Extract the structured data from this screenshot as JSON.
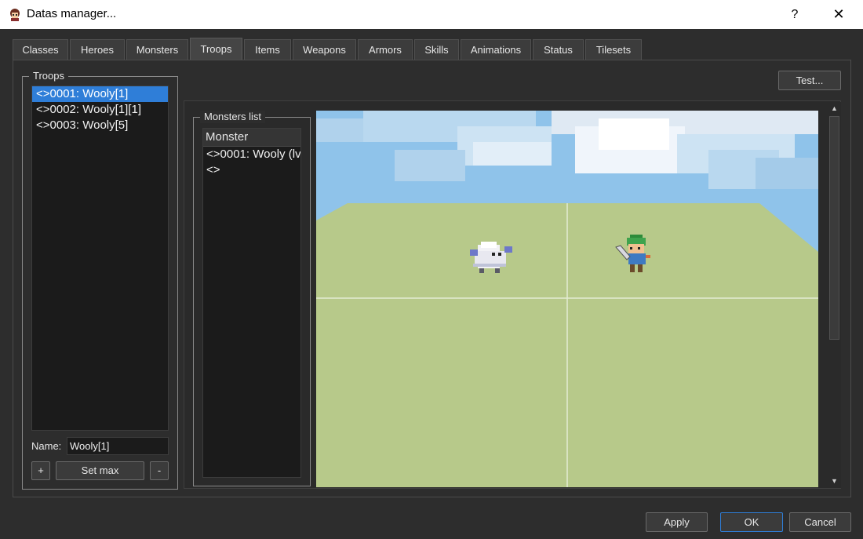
{
  "window": {
    "title": "Datas manager...",
    "help_label": "?",
    "close_label": "✕"
  },
  "tabs": [
    {
      "label": "Classes"
    },
    {
      "label": "Heroes"
    },
    {
      "label": "Monsters"
    },
    {
      "label": "Troops",
      "active": true
    },
    {
      "label": "Items"
    },
    {
      "label": "Weapons"
    },
    {
      "label": "Armors"
    },
    {
      "label": "Skills"
    },
    {
      "label": "Animations"
    },
    {
      "label": "Status"
    },
    {
      "label": "Tilesets"
    }
  ],
  "troops": {
    "group_title": "Troops",
    "items": [
      {
        "label": "<>0001: Wooly[1]",
        "selected": true
      },
      {
        "label": "<>0002: Wooly[1][1]"
      },
      {
        "label": "<>0003: Wooly[5]"
      }
    ],
    "name_label": "Name:",
    "name_value": "Wooly[1]",
    "add_label": "+",
    "set_max_label": "Set max",
    "remove_label": "-"
  },
  "test_button_label": "Test...",
  "monsters_list": {
    "group_title": "Monsters list",
    "header": "Monster",
    "items": [
      {
        "label": "<>0001: Wooly (lv"
      },
      {
        "label": "<>"
      }
    ]
  },
  "scene": {
    "sky_color": "#8fc3ea",
    "ground_color": "#b7c98a",
    "icons": [
      "wooly-monster-sprite",
      "hero-sprite"
    ]
  },
  "footer": {
    "apply_label": "Apply",
    "ok_label": "OK",
    "cancel_label": "Cancel"
  },
  "colors": {
    "accent": "#2f7ed8",
    "background": "#2d2d2d"
  }
}
